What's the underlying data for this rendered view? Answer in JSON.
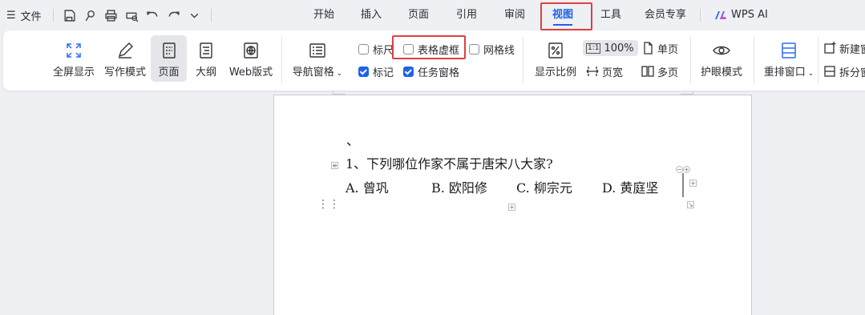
{
  "menubar": {
    "file_label": "文件",
    "tabs": [
      "开始",
      "插入",
      "页面",
      "引用",
      "审阅",
      "视图",
      "工具",
      "会员专享",
      "WPS AI"
    ],
    "active_tab": "视图"
  },
  "ribbon": {
    "fullscreen": "全屏显示",
    "writing_mode": "写作模式",
    "page_view": "页面",
    "outline": "大纲",
    "web_layout": "Web版式",
    "nav_pane": "导航窗格",
    "ruler": "标尺",
    "table_gridlines": "表格虚框",
    "gridlines": "网格线",
    "marks": "标记",
    "task_pane": "任务窗格",
    "zoom": "显示比例",
    "zoom_value": "100%",
    "zoom_icon_text": "1:1",
    "page_width": "页宽",
    "single_page": "单页",
    "multi_page": "多页",
    "eye_protect": "护眼模式",
    "rearrange_window": "重排窗口",
    "new_window": "新建窗",
    "split_window": "拆分窗"
  },
  "checkbox_state": {
    "ruler": false,
    "table_gridlines": false,
    "gridlines": false,
    "marks": true,
    "task_pane": true
  },
  "document": {
    "stray_mark": "、",
    "question": "1、下列哪位作家不属于唐宋八大家?",
    "options": [
      "A. 曾巩",
      "B. 欧阳修",
      "C. 柳宗元",
      "D. 黄庭坚"
    ]
  }
}
